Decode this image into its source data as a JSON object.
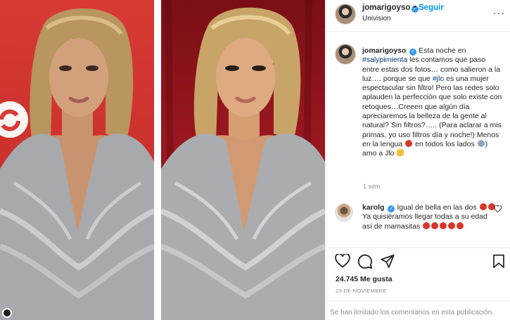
{
  "header": {
    "username": "jomarigoyso",
    "verified_glyph": "✓",
    "dot": "•",
    "follow_label": "Seguir",
    "location": "Univision",
    "more_glyph": "···"
  },
  "caption": {
    "username": "jomarigoyso",
    "text_1": "Esta noche en",
    "hashtag_1": "#salypimienta",
    "text_2": "les contamos que paso entre estas dos fotos… como salieron a la luz…. porque se que",
    "hashtag_2": "#jlo",
    "text_3": "es una mujer espectacular sin filtro! Pero las redes solo aplauden la perfección que solo existe con retoques…Creeen que algún día apreciaremos la belleza de la gente al natural? Sin filtros?….. (Para aclarar a mis primas, yo uso filtros día y noche!) Menos en la lengua",
    "text_4": "en todos los lados",
    "text_5": "amo a Jlo",
    "time": "1 sem"
  },
  "comment": {
    "username": "karolg",
    "text": "Igual de bella en las dos",
    "text_2": "Ya quisiéramos llegar todas a su edad así de mamasitas"
  },
  "actions": {
    "like_icon": "heart-outline-icon",
    "comment_icon": "comment-icon",
    "share_icon": "paper-plane-icon",
    "save_icon": "bookmark-icon"
  },
  "likes_text": "24.745 Me gusta",
  "date_text": "23 DE NOVIEMBRE",
  "comments_limited": "Se han limitado los comentarios en esta publicación.",
  "colors": {
    "accent": "#0095f6",
    "verified": "#3897f0",
    "left_bg": "#d83a34",
    "right_bg": "#9b1820"
  }
}
